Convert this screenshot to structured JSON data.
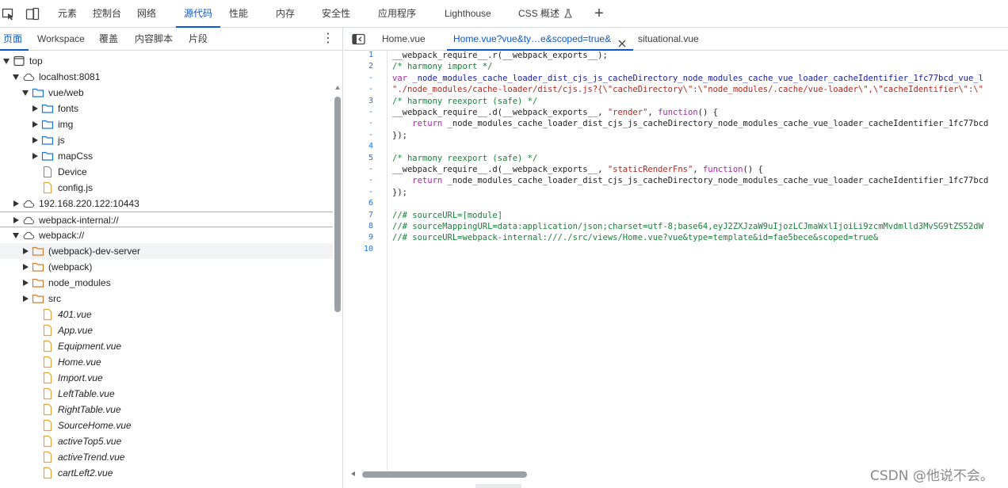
{
  "toolbar": {
    "icons": [
      "inspect-icon",
      "device-toggle-icon"
    ],
    "tabs": [
      "元素",
      "控制台",
      "网络",
      "源代码",
      "性能",
      "内存",
      "安全性",
      "应用程序",
      "Lighthouse",
      "CSS 概述"
    ],
    "active_tab": "源代码",
    "more_tabs_symbol": "+"
  },
  "navigator": {
    "tabs": [
      "页面",
      "Workspace",
      "覆盖",
      "内容脚本",
      "片段"
    ],
    "active_tab": "页面",
    "menu_symbol": "⋮",
    "tree": [
      {
        "label": "top",
        "icon": "frame-icon",
        "arrow": "down",
        "level": 0
      },
      {
        "label": "localhost:8081",
        "icon": "cloud-icon",
        "arrow": "down",
        "level": 1
      },
      {
        "label": "vue/web",
        "icon": "folder-icon",
        "arrow": "down",
        "level": 2
      },
      {
        "label": "fonts",
        "icon": "folder-icon",
        "arrow": "right",
        "level": 3
      },
      {
        "label": "img",
        "icon": "folder-icon",
        "arrow": "right",
        "level": 3
      },
      {
        "label": "js",
        "icon": "folder-icon",
        "arrow": "right",
        "level": 3
      },
      {
        "label": "mapCss",
        "icon": "folder-icon",
        "arrow": "right",
        "level": 3
      },
      {
        "label": "Device",
        "icon": "file-icon",
        "arrow": "none",
        "level": 3
      },
      {
        "label": "config.js",
        "icon": "js-file-icon",
        "arrow": "none",
        "level": 3
      },
      {
        "label": "192.168.220.122:10443",
        "icon": "cloud-icon",
        "arrow": "right",
        "level": 1
      },
      {
        "label": "webpack-internal://",
        "icon": "cloud-icon",
        "arrow": "right",
        "level": 1
      },
      {
        "label": "webpack://",
        "icon": "cloud-icon",
        "arrow": "down",
        "level": 1
      },
      {
        "label": "(webpack)-dev-server",
        "icon": "folder-orange-icon",
        "arrow": "right",
        "level": 2
      },
      {
        "label": "(webpack)",
        "icon": "folder-orange-icon",
        "arrow": "right",
        "level": 2
      },
      {
        "label": "node_modules",
        "icon": "folder-orange-icon",
        "arrow": "right",
        "level": 2
      },
      {
        "label": "src",
        "icon": "folder-orange-icon",
        "arrow": "right",
        "level": 2
      },
      {
        "label": "401.vue",
        "icon": "js-file-icon",
        "arrow": "none",
        "level": 3
      },
      {
        "label": "App.vue",
        "icon": "js-file-icon",
        "arrow": "none",
        "level": 3
      },
      {
        "label": "Equipment.vue",
        "icon": "js-file-icon",
        "arrow": "none",
        "level": 3
      },
      {
        "label": "Home.vue",
        "icon": "js-file-icon",
        "arrow": "none",
        "level": 3
      },
      {
        "label": "Import.vue",
        "icon": "js-file-icon",
        "arrow": "none",
        "level": 3
      },
      {
        "label": "LeftTable.vue",
        "icon": "js-file-icon",
        "arrow": "none",
        "level": 3
      },
      {
        "label": "RightTable.vue",
        "icon": "js-file-icon",
        "arrow": "none",
        "level": 3
      },
      {
        "label": "SourceHome.vue",
        "icon": "js-file-icon",
        "arrow": "none",
        "level": 3
      },
      {
        "label": "activeTop5.vue",
        "icon": "js-file-icon",
        "arrow": "none",
        "level": 3
      },
      {
        "label": "activeTrend.vue",
        "icon": "js-file-icon",
        "arrow": "none",
        "level": 3
      },
      {
        "label": "cartLeft2.vue",
        "icon": "js-file-icon",
        "arrow": "none",
        "level": 3
      }
    ]
  },
  "editor": {
    "tabs": [
      {
        "label": "Home.vue",
        "active": false
      },
      {
        "label": "Home.vue?vue&ty…e&scoped=true&",
        "active": true
      },
      {
        "label": "situational.vue",
        "active": false
      }
    ],
    "line_numbers": [
      "1",
      "2",
      "-",
      "-",
      "3",
      "-",
      "-",
      "-",
      "4",
      "5",
      "-",
      "-",
      "-",
      "6",
      "7",
      "8",
      "9",
      "10"
    ],
    "lines": [
      [
        {
          "t": "__webpack_require__.r(__webpack_exports__);",
          "c": "plain"
        }
      ],
      [
        {
          "t": "/* harmony import */",
          "c": "com"
        }
      ],
      [
        {
          "t": "var ",
          "c": "kw"
        },
        {
          "t": "_node_modules_cache_loader_dist_cjs_js_cacheDirectory_node_modules_cache_vue_loader_cacheIdentifier_1fc77bcd_vue_l",
          "c": "var"
        }
      ],
      [
        {
          "t": "\"./node_modules/cache-loader/dist/cjs.js?{\\\"cacheDirectory\\\":\\\"node_modules/.cache/vue-loader\\\",\\\"cacheIdentifier\\\":\\\"",
          "c": "str"
        }
      ],
      [
        {
          "t": "/* harmony reexport (safe) */",
          "c": "com"
        }
      ],
      [
        {
          "t": "__webpack_require__.d(__webpack_exports__, ",
          "c": "plain"
        },
        {
          "t": "\"render\"",
          "c": "str"
        },
        {
          "t": ", ",
          "c": "plain"
        },
        {
          "t": "function",
          "c": "kw"
        },
        {
          "t": "() {",
          "c": "plain"
        }
      ],
      [
        {
          "t": "    ",
          "c": "plain"
        },
        {
          "t": "return",
          "c": "kw"
        },
        {
          "t": " _node_modules_cache_loader_dist_cjs_js_cacheDirectory_node_modules_cache_vue_loader_cacheIdentifier_1fc77bcd",
          "c": "plain"
        }
      ],
      [
        {
          "t": "});",
          "c": "plain"
        }
      ],
      [
        {
          "t": "",
          "c": "plain"
        }
      ],
      [
        {
          "t": "/* harmony reexport (safe) */",
          "c": "com"
        }
      ],
      [
        {
          "t": "__webpack_require__.d(__webpack_exports__, ",
          "c": "plain"
        },
        {
          "t": "\"staticRenderFns\"",
          "c": "str"
        },
        {
          "t": ", ",
          "c": "plain"
        },
        {
          "t": "function",
          "c": "kw"
        },
        {
          "t": "() {",
          "c": "plain"
        }
      ],
      [
        {
          "t": "    ",
          "c": "plain"
        },
        {
          "t": "return",
          "c": "kw"
        },
        {
          "t": " _node_modules_cache_loader_dist_cjs_js_cacheDirectory_node_modules_cache_vue_loader_cacheIdentifier_1fc77bcd",
          "c": "plain"
        }
      ],
      [
        {
          "t": "});",
          "c": "plain"
        }
      ],
      [
        {
          "t": "",
          "c": "plain"
        }
      ],
      [
        {
          "t": "//# sourceURL=[module]",
          "c": "com"
        }
      ],
      [
        {
          "t": "//# sourceMappingURL=data:application/json;charset=utf-8;base64,eyJ2ZXJzaW9uIjozLCJmaWxlIjoiLi9zcmMvdmlld3MvSG9tZS52dW",
          "c": "com"
        }
      ],
      [
        {
          "t": "//# sourceURL=webpack-internal:///./src/views/Home.vue?vue&type=template&id=fae5bece&scoped=true&",
          "c": "com"
        }
      ],
      [
        {
          "t": "",
          "c": "plain"
        }
      ]
    ]
  },
  "watermark": "CSDN @他说不会。",
  "colors": {
    "accent": "#0b57d0",
    "comment": "#188038",
    "string": "#b3261e",
    "keyword": "#a626a4",
    "variable": "#1a1aa6",
    "line_number": "#1a73e8"
  }
}
